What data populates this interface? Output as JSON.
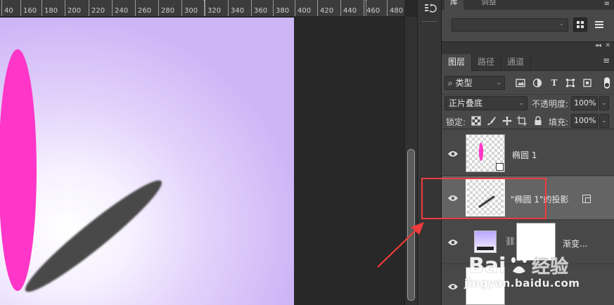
{
  "ruler": {
    "labels": [
      "40",
      "160",
      "180",
      "200",
      "220",
      "240",
      "260",
      "280",
      "300",
      "320",
      "340",
      "360",
      "380",
      "400",
      "420",
      "440",
      "460",
      "480"
    ]
  },
  "library_panel": {
    "tabs": [
      "库",
      "调整"
    ]
  },
  "layers_panel": {
    "tabs": [
      "图层",
      "路径",
      "通道"
    ],
    "filter_kind": "类型",
    "blend_mode": "正片叠底",
    "opacity_label": "不透明度:",
    "opacity_value": "100%",
    "lock_label": "锁定:",
    "fill_label": "填充:",
    "fill_value": "100%",
    "layers": [
      {
        "name": "椭圆 1"
      },
      {
        "name": "\"椭圆 1\"的投影"
      },
      {
        "name": "渐变..."
      }
    ]
  },
  "watermark": {
    "logo": "Bai度经验",
    "domain": "jingyan.baidu.com"
  },
  "colors": {
    "ellipse": "#ff36c7",
    "shadow": "#484848",
    "annotation": "#f03b3b"
  }
}
